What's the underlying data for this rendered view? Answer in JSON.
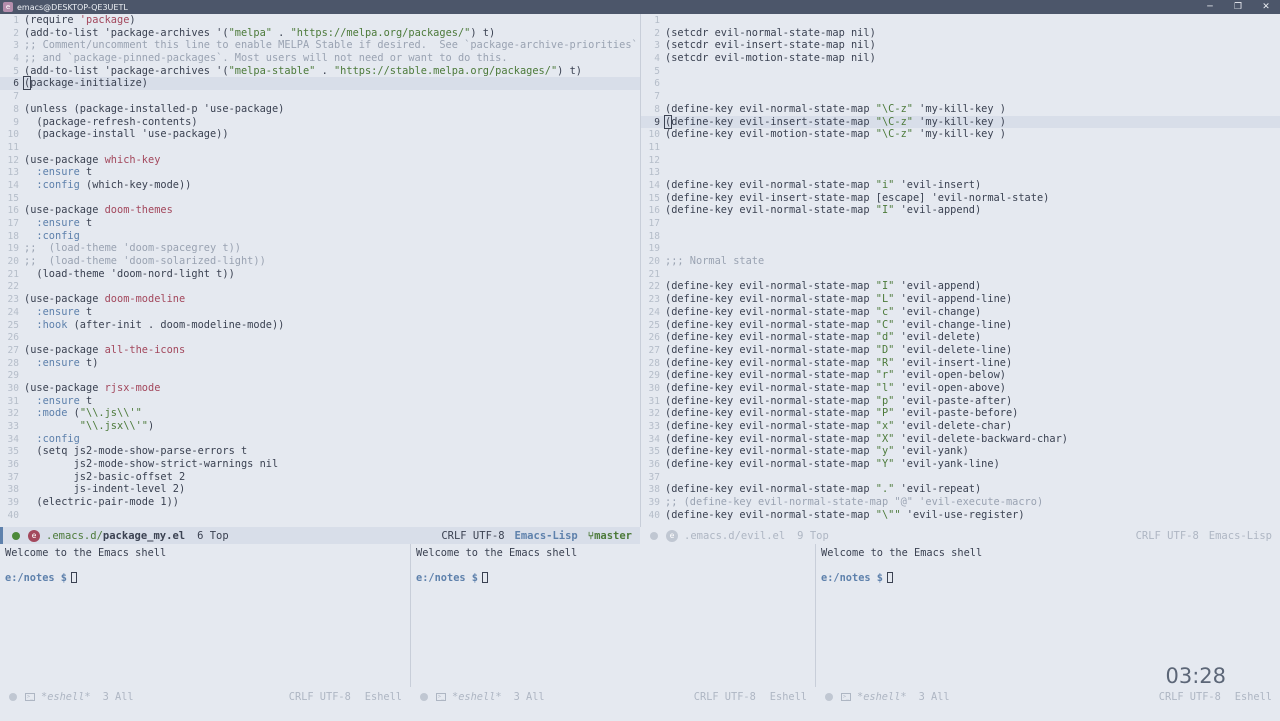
{
  "window": {
    "title": "emacs@DESKTOP-QE3UETL",
    "controls": {
      "minimize": "─",
      "maximize": "❐",
      "close": "✕"
    }
  },
  "left_buffer": {
    "lines": [
      {
        "n": "1",
        "t": [
          [
            "kw",
            "(require "
          ],
          [
            "pkg",
            "'package"
          ],
          [
            "kw",
            ")"
          ]
        ]
      },
      {
        "n": "2",
        "t": [
          [
            "kw",
            "(add-to-list 'package-archives '("
          ],
          [
            "str",
            "\"melpa\""
          ],
          [
            "kw",
            " . "
          ],
          [
            "str",
            "\"https://melpa.org/packages/\""
          ],
          [
            "kw",
            ") t)"
          ]
        ]
      },
      {
        "n": "3",
        "t": [
          [
            "cmt",
            ";; Comment/uncomment this line to enable MELPA Stable if desired.  See `package-archive-priorities`"
          ]
        ]
      },
      {
        "n": "4",
        "t": [
          [
            "cmt",
            ";; and `package-pinned-packages`. Most users will not need or want to do this."
          ]
        ]
      },
      {
        "n": "5",
        "t": [
          [
            "kw",
            "(add-to-list 'package-archives '("
          ],
          [
            "str",
            "\"melpa-stable\""
          ],
          [
            "kw",
            " . "
          ],
          [
            "str",
            "\"https://stable.melpa.org/packages/\""
          ],
          [
            "kw",
            ") t)"
          ]
        ]
      },
      {
        "n": "6",
        "t": [
          [
            "cur",
            "("
          ],
          [
            "kw",
            "package-initialize)"
          ]
        ],
        "current": true
      },
      {
        "n": "7",
        "t": []
      },
      {
        "n": "8",
        "t": [
          [
            "kw",
            "(unless (package-installed-p 'use-package)"
          ]
        ]
      },
      {
        "n": "9",
        "t": [
          [
            "kw",
            "  (package-refresh-contents)"
          ]
        ]
      },
      {
        "n": "10",
        "t": [
          [
            "kw",
            "  (package-install 'use-package))"
          ]
        ]
      },
      {
        "n": "11",
        "t": []
      },
      {
        "n": "12",
        "t": [
          [
            "kw",
            "(use-package "
          ],
          [
            "pkg",
            "which-key"
          ]
        ]
      },
      {
        "n": "13",
        "t": [
          [
            "key",
            "  :ensure"
          ],
          [
            "kw",
            " t"
          ]
        ]
      },
      {
        "n": "14",
        "t": [
          [
            "key",
            "  :config"
          ],
          [
            "kw",
            " (which-key-mode))"
          ]
        ]
      },
      {
        "n": "15",
        "t": []
      },
      {
        "n": "16",
        "t": [
          [
            "kw",
            "(use-package "
          ],
          [
            "pkg",
            "doom-themes"
          ]
        ]
      },
      {
        "n": "17",
        "t": [
          [
            "key",
            "  :ensure"
          ],
          [
            "kw",
            " t"
          ]
        ]
      },
      {
        "n": "18",
        "t": [
          [
            "key",
            "  :config"
          ]
        ]
      },
      {
        "n": "19",
        "t": [
          [
            "cmt",
            ";;  (load-theme 'doom-spacegrey t))"
          ]
        ]
      },
      {
        "n": "20",
        "t": [
          [
            "cmt",
            ";;  (load-theme 'doom-solarized-light))"
          ]
        ]
      },
      {
        "n": "21",
        "t": [
          [
            "kw",
            "  (load-theme 'doom-nord-light t))"
          ]
        ]
      },
      {
        "n": "22",
        "t": []
      },
      {
        "n": "23",
        "t": [
          [
            "kw",
            "(use-package "
          ],
          [
            "pkg",
            "doom-modeline"
          ]
        ]
      },
      {
        "n": "24",
        "t": [
          [
            "key",
            "  :ensure"
          ],
          [
            "kw",
            " t"
          ]
        ]
      },
      {
        "n": "25",
        "t": [
          [
            "key",
            "  :hook"
          ],
          [
            "kw",
            " (after-init . doom-modeline-mode))"
          ]
        ]
      },
      {
        "n": "26",
        "t": []
      },
      {
        "n": "27",
        "t": [
          [
            "kw",
            "(use-package "
          ],
          [
            "pkg",
            "all-the-icons"
          ]
        ]
      },
      {
        "n": "28",
        "t": [
          [
            "key",
            "  :ensure"
          ],
          [
            "kw",
            " t)"
          ]
        ]
      },
      {
        "n": "29",
        "t": []
      },
      {
        "n": "30",
        "t": [
          [
            "kw",
            "(use-package "
          ],
          [
            "pkg",
            "rjsx-mode"
          ]
        ]
      },
      {
        "n": "31",
        "t": [
          [
            "key",
            "  :ensure"
          ],
          [
            "kw",
            " t"
          ]
        ]
      },
      {
        "n": "32",
        "t": [
          [
            "key",
            "  :mode"
          ],
          [
            "kw",
            " ("
          ],
          [
            "str",
            "\"\\\\.js\\\\'\""
          ]
        ]
      },
      {
        "n": "33",
        "t": [
          [
            "kw",
            "         "
          ],
          [
            "str",
            "\"\\\\.jsx\\\\'\""
          ],
          [
            "kw",
            ")"
          ]
        ]
      },
      {
        "n": "34",
        "t": [
          [
            "key",
            "  :config"
          ]
        ]
      },
      {
        "n": "35",
        "t": [
          [
            "kw",
            "  (setq js2-mode-show-parse-errors t"
          ]
        ]
      },
      {
        "n": "36",
        "t": [
          [
            "kw",
            "        js2-mode-show-strict-warnings nil"
          ]
        ]
      },
      {
        "n": "37",
        "t": [
          [
            "kw",
            "        js2-basic-offset 2"
          ]
        ]
      },
      {
        "n": "38",
        "t": [
          [
            "kw",
            "        js-indent-level 2)"
          ]
        ]
      },
      {
        "n": "39",
        "t": [
          [
            "kw",
            "  (electric-pair-mode 1))"
          ]
        ]
      },
      {
        "n": "40",
        "t": []
      }
    ]
  },
  "right_buffer": {
    "lines": [
      {
        "n": "1",
        "t": []
      },
      {
        "n": "2",
        "t": [
          [
            "kw",
            "(setcdr evil-normal-state-map nil)"
          ]
        ]
      },
      {
        "n": "3",
        "t": [
          [
            "kw",
            "(setcdr evil-insert-state-map nil)"
          ]
        ]
      },
      {
        "n": "4",
        "t": [
          [
            "kw",
            "(setcdr evil-motion-state-map nil)"
          ]
        ]
      },
      {
        "n": "5",
        "t": []
      },
      {
        "n": "6",
        "t": []
      },
      {
        "n": "7",
        "t": []
      },
      {
        "n": "8",
        "t": [
          [
            "kw",
            "(define-key evil-normal-state-map "
          ],
          [
            "str",
            "\"\\C-z\""
          ],
          [
            "kw",
            " 'my-kill-key )"
          ]
        ]
      },
      {
        "n": "9",
        "t": [
          [
            "cur",
            "("
          ],
          [
            "kw",
            "define-key evil-insert-state-map "
          ],
          [
            "str",
            "\"\\C-z\""
          ],
          [
            "kw",
            " 'my-kill-key )"
          ]
        ],
        "current": true
      },
      {
        "n": "10",
        "t": [
          [
            "kw",
            "(define-key evil-motion-state-map "
          ],
          [
            "str",
            "\"\\C-z\""
          ],
          [
            "kw",
            " 'my-kill-key )"
          ]
        ]
      },
      {
        "n": "11",
        "t": []
      },
      {
        "n": "12",
        "t": []
      },
      {
        "n": "13",
        "t": []
      },
      {
        "n": "14",
        "t": [
          [
            "kw",
            "(define-key evil-normal-state-map "
          ],
          [
            "str",
            "\"i\""
          ],
          [
            "kw",
            " 'evil-insert)"
          ]
        ]
      },
      {
        "n": "15",
        "t": [
          [
            "kw",
            "(define-key evil-insert-state-map [escape] 'evil-normal-state)"
          ]
        ]
      },
      {
        "n": "16",
        "t": [
          [
            "kw",
            "(define-key evil-normal-state-map "
          ],
          [
            "str",
            "\"I\""
          ],
          [
            "kw",
            " 'evil-append)"
          ]
        ]
      },
      {
        "n": "17",
        "t": []
      },
      {
        "n": "18",
        "t": []
      },
      {
        "n": "19",
        "t": []
      },
      {
        "n": "20",
        "t": [
          [
            "cmt",
            ";;; Normal state"
          ]
        ]
      },
      {
        "n": "21",
        "t": []
      },
      {
        "n": "22",
        "t": [
          [
            "kw",
            "(define-key evil-normal-state-map "
          ],
          [
            "str",
            "\"I\""
          ],
          [
            "kw",
            " 'evil-append)"
          ]
        ]
      },
      {
        "n": "23",
        "t": [
          [
            "kw",
            "(define-key evil-normal-state-map "
          ],
          [
            "str",
            "\"L\""
          ],
          [
            "kw",
            " 'evil-append-line)"
          ]
        ]
      },
      {
        "n": "24",
        "t": [
          [
            "kw",
            "(define-key evil-normal-state-map "
          ],
          [
            "str",
            "\"c\""
          ],
          [
            "kw",
            " 'evil-change)"
          ]
        ]
      },
      {
        "n": "25",
        "t": [
          [
            "kw",
            "(define-key evil-normal-state-map "
          ],
          [
            "str",
            "\"C\""
          ],
          [
            "kw",
            " 'evil-change-line)"
          ]
        ]
      },
      {
        "n": "26",
        "t": [
          [
            "kw",
            "(define-key evil-normal-state-map "
          ],
          [
            "str",
            "\"d\""
          ],
          [
            "kw",
            " 'evil-delete)"
          ]
        ]
      },
      {
        "n": "27",
        "t": [
          [
            "kw",
            "(define-key evil-normal-state-map "
          ],
          [
            "str",
            "\"D\""
          ],
          [
            "kw",
            " 'evil-delete-line)"
          ]
        ]
      },
      {
        "n": "28",
        "t": [
          [
            "kw",
            "(define-key evil-normal-state-map "
          ],
          [
            "str",
            "\"R\""
          ],
          [
            "kw",
            " 'evil-insert-line)"
          ]
        ]
      },
      {
        "n": "29",
        "t": [
          [
            "kw",
            "(define-key evil-normal-state-map "
          ],
          [
            "str",
            "\"r\""
          ],
          [
            "kw",
            " 'evil-open-below)"
          ]
        ]
      },
      {
        "n": "30",
        "t": [
          [
            "kw",
            "(define-key evil-normal-state-map "
          ],
          [
            "str",
            "\"l\""
          ],
          [
            "kw",
            " 'evil-open-above)"
          ]
        ]
      },
      {
        "n": "31",
        "t": [
          [
            "kw",
            "(define-key evil-normal-state-map "
          ],
          [
            "str",
            "\"p\""
          ],
          [
            "kw",
            " 'evil-paste-after)"
          ]
        ]
      },
      {
        "n": "32",
        "t": [
          [
            "kw",
            "(define-key evil-normal-state-map "
          ],
          [
            "str",
            "\"P\""
          ],
          [
            "kw",
            " 'evil-paste-before)"
          ]
        ]
      },
      {
        "n": "33",
        "t": [
          [
            "kw",
            "(define-key evil-normal-state-map "
          ],
          [
            "str",
            "\"x\""
          ],
          [
            "kw",
            " 'evil-delete-char)"
          ]
        ]
      },
      {
        "n": "34",
        "t": [
          [
            "kw",
            "(define-key evil-normal-state-map "
          ],
          [
            "str",
            "\"X\""
          ],
          [
            "kw",
            " 'evil-delete-backward-char)"
          ]
        ]
      },
      {
        "n": "35",
        "t": [
          [
            "kw",
            "(define-key evil-normal-state-map "
          ],
          [
            "str",
            "\"y\""
          ],
          [
            "kw",
            " 'evil-yank)"
          ]
        ]
      },
      {
        "n": "36",
        "t": [
          [
            "kw",
            "(define-key evil-normal-state-map "
          ],
          [
            "str",
            "\"Y\""
          ],
          [
            "kw",
            " 'evil-yank-line)"
          ]
        ]
      },
      {
        "n": "37",
        "t": []
      },
      {
        "n": "38",
        "t": [
          [
            "kw",
            "(define-key evil-normal-state-map "
          ],
          [
            "str",
            "\".\""
          ],
          [
            "kw",
            " 'evil-repeat)"
          ]
        ]
      },
      {
        "n": "39",
        "t": [
          [
            "cmt",
            ";; (define-key evil-normal-state-map \"@\" 'evil-execute-macro)"
          ]
        ]
      },
      {
        "n": "40",
        "t": [
          [
            "kw",
            "(define-key evil-normal-state-map "
          ],
          [
            "str",
            "\"\\\"\""
          ],
          [
            "kw",
            " 'evil-use-register)"
          ]
        ]
      }
    ]
  },
  "modeline_left": {
    "dir": ".emacs.d/",
    "file": "package_my.el",
    "position": "6 Top",
    "encoding": "CRLF UTF-8",
    "mode": "Emacs-Lisp",
    "branch": "master"
  },
  "modeline_right": {
    "dir": ".emacs.d/",
    "file": "evil.el",
    "position": "9 Top",
    "encoding": "CRLF UTF-8",
    "mode": "Emacs-Lisp"
  },
  "shells": [
    {
      "welcome": "Welcome to the Emacs shell",
      "prompt": "e:/notes $",
      "name": "*eshell*",
      "position": "3 All",
      "encoding": "CRLF UTF-8",
      "mode": "Eshell"
    },
    {
      "welcome": "Welcome to the Emacs shell",
      "prompt": "e:/notes $",
      "name": "*eshell*",
      "position": "3 All",
      "encoding": "CRLF UTF-8",
      "mode": "Eshell"
    },
    {
      "welcome": "Welcome to the Emacs shell",
      "prompt": "e:/notes $",
      "name": "*eshell*",
      "position": "3 All",
      "encoding": "CRLF UTF-8",
      "mode": "Eshell"
    }
  ],
  "clock": "03:28",
  "colors": {
    "accent": "#5e81ac",
    "string": "#4c7a3a",
    "package": "#a3485d",
    "comment": "#9aa3b2",
    "background": "#e5e9f0"
  }
}
